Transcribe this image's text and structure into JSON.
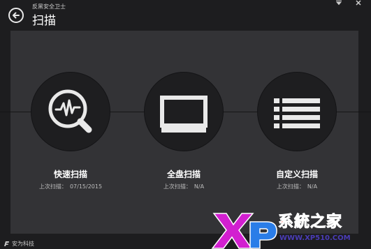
{
  "app": {
    "name": "反黑安全卫士",
    "page_title": "扫描"
  },
  "window": {
    "min_icon": "minimize-icon",
    "close_icon": "close-icon"
  },
  "scan_options": [
    {
      "label": "快速扫描",
      "last_scan_label": "上次扫描：",
      "last_scan_value": "07/15/2015",
      "icon": "magnifier-pulse-icon"
    },
    {
      "label": "全盘扫描",
      "last_scan_label": "上次扫描：",
      "last_scan_value": "N/A",
      "icon": "monitor-icon"
    },
    {
      "label": "自定义扫描",
      "last_scan_label": "上次扫描：",
      "last_scan_value": "N/A",
      "icon": "list-icon"
    }
  ],
  "footer": {
    "vendor": "安为科技"
  },
  "watermark": {
    "brand": "XP",
    "text": "系統之家",
    "url": "WWW.XP510.COM"
  },
  "colors": {
    "background": "#1d1d1f",
    "panel": "#333336",
    "circle": "#1e1e20",
    "watermark_red": "#ff3a2e"
  }
}
